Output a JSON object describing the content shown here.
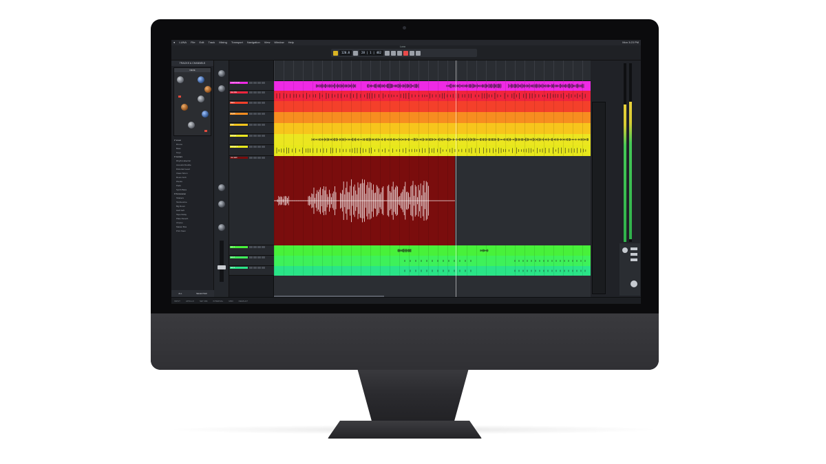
{
  "menubar": {
    "app": "LUNA",
    "items": [
      "File",
      "Edit",
      "Track",
      "Mixing",
      "Transport",
      "Navigation",
      "View",
      "Window",
      "Help"
    ],
    "clock": "Mon 3:23 PM"
  },
  "transport": {
    "doc_title": "Luna",
    "tempo": "120.0",
    "timecode": "28 | 1 | 462"
  },
  "browser": {
    "title": "TRACKS & CHANNELS",
    "plugin_name": "NEVE",
    "list": [
      {
        "label": "Vocal",
        "cat": true
      },
      {
        "label": "Drums",
        "cat": false
      },
      {
        "label": "Bass",
        "cat": false
      },
      {
        "label": "Keys",
        "cat": false
      },
      {
        "label": "Guitars",
        "cat": true
      },
      {
        "label": "Rhythm Electric",
        "cat": false
      },
      {
        "label": "Acoustic Double",
        "cat": false
      },
      {
        "label": "Distorted Lead",
        "cat": false
      },
      {
        "label": "Clean Strum",
        "cat": false
      },
      {
        "label": "Room Amb",
        "cat": false
      },
      {
        "label": "Plucks",
        "cat": false
      },
      {
        "label": "Pads",
        "cat": false
      },
      {
        "label": "Synth Bass",
        "cat": false
      },
      {
        "label": "Percussion",
        "cat": true
      },
      {
        "label": "Shakers",
        "cat": false
      },
      {
        "label": "Tambourine",
        "cat": false
      },
      {
        "label": "Big Room",
        "cat": false
      },
      {
        "label": "Hall Verb",
        "cat": false
      },
      {
        "label": "Tape Delay",
        "cat": false
      },
      {
        "label": "Plate Reverb",
        "cat": false
      },
      {
        "label": "Chorus",
        "cat": false
      },
      {
        "label": "Master Bus",
        "cat": false
      },
      {
        "label": "Print Stem",
        "cat": false
      }
    ],
    "footer": [
      "ALL",
      "SELECTED"
    ]
  },
  "tracks": [
    {
      "name": "Lead Vocal",
      "color": "#ee2ae4",
      "height": 14,
      "wave": "vox"
    },
    {
      "name": "Vox Dbl",
      "color": "#f0243d",
      "height": 15,
      "wave": "perc"
    },
    {
      "name": "Bass",
      "color": "#f4402a",
      "height": 16,
      "wave": "none"
    },
    {
      "name": "Synth",
      "color": "#f78d20",
      "height": 16,
      "wave": "none"
    },
    {
      "name": "Pad",
      "color": "#f7c51c",
      "height": 16,
      "wave": "none"
    },
    {
      "name": "Strings",
      "color": "#ebe620",
      "height": 16,
      "wave": "ambient"
    },
    {
      "name": "Strings 2",
      "color": "#e7e81c",
      "height": 16,
      "wave": "perc"
    },
    {
      "name": "Vox Edit",
      "color": "#7a0d0d",
      "height": 130,
      "wave": "big"
    },
    {
      "name": "Gtr 1",
      "color": "#48f13a",
      "height": 15,
      "wave": "sparse"
    },
    {
      "name": "Gtr 2",
      "color": "#3ef15a",
      "height": 15,
      "wave": "ticks"
    },
    {
      "name": "Gtr 3",
      "color": "#2ae487",
      "height": 14,
      "wave": "ticks"
    }
  ],
  "status": [
    "INPUT",
    "APOLLO",
    "SET 48k",
    "INTERNAL",
    "MIDI",
    "DEFAULT"
  ],
  "colors": {
    "screen_bg": "#1a1c20",
    "empty_track": "#2b2e33"
  }
}
